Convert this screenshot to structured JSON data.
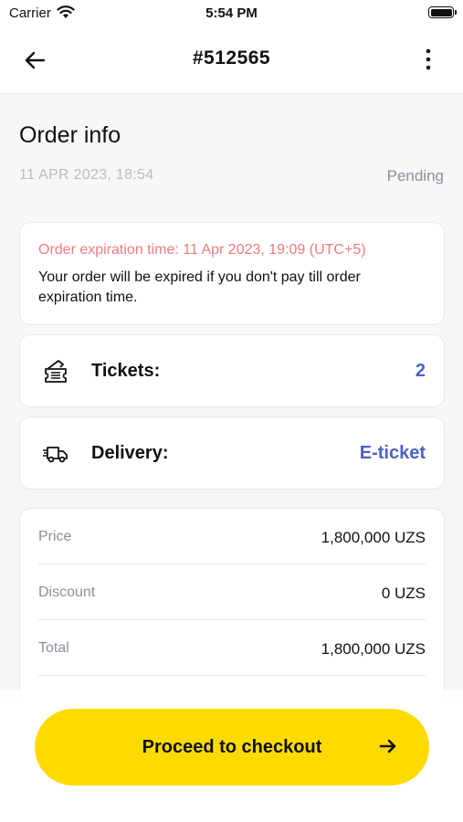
{
  "status_bar": {
    "carrier": "Carrier",
    "time": "5:54 PM"
  },
  "header": {
    "title": "#512565"
  },
  "page_title": "Order info",
  "order": {
    "date": "11 APR 2023, 18:54",
    "status": "Pending"
  },
  "expiration": {
    "warning": "Order expiration time: 11 Apr 2023, 19:09 (UTC+5)",
    "message": "Your order will be expired if you don't pay till order expiration time."
  },
  "tickets": {
    "label": "Tickets:",
    "value": "2"
  },
  "delivery": {
    "label": "Delivery:",
    "value": "E-ticket"
  },
  "summary": {
    "rows": [
      {
        "label": "Price",
        "value": "1,800,000 UZS"
      },
      {
        "label": "Discount",
        "value": "0 UZS"
      },
      {
        "label": "Total",
        "value": "1,800,000 UZS"
      }
    ]
  },
  "checkout": {
    "label": "Proceed to checkout"
  },
  "colors": {
    "accent": "#4b61c9",
    "warning": "#ef7b80",
    "button": "#fddb00",
    "muted": "#8a8f9b"
  }
}
